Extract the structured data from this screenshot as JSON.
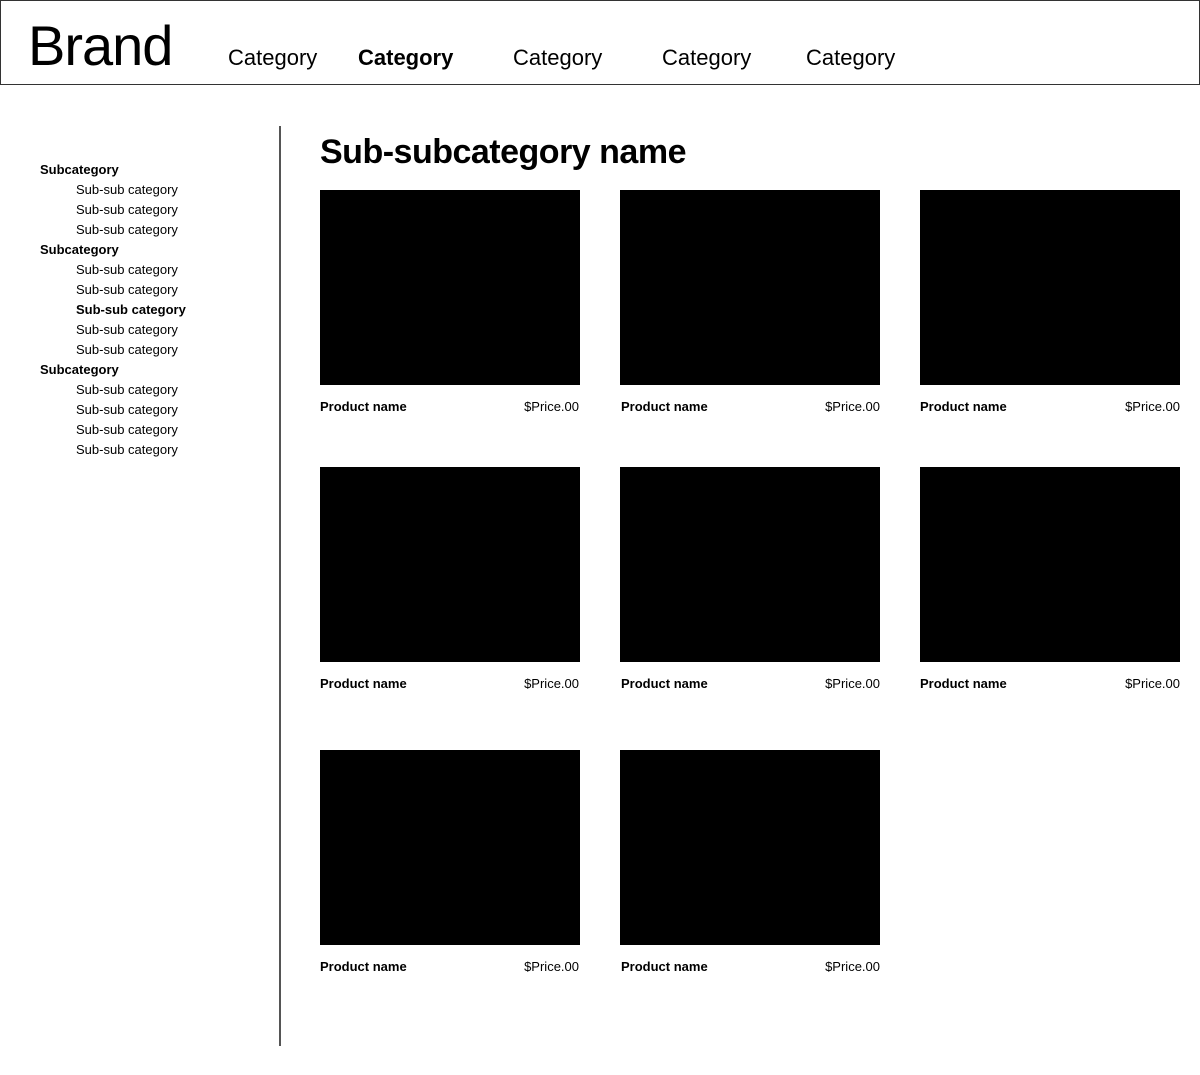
{
  "header": {
    "brand": "Brand",
    "nav": [
      {
        "label": "Category",
        "active": false
      },
      {
        "label": "Category",
        "active": true
      },
      {
        "label": "Category",
        "active": false
      },
      {
        "label": "Category",
        "active": false
      },
      {
        "label": "Category",
        "active": false
      }
    ]
  },
  "sidebar": {
    "groups": [
      {
        "label": "Subcategory",
        "items": [
          {
            "label": "Sub-sub category"
          },
          {
            "label": "Sub-sub category"
          },
          {
            "label": "Sub-sub category"
          }
        ]
      },
      {
        "label": "Subcategory",
        "items": [
          {
            "label": "Sub-sub category"
          },
          {
            "label": "Sub-sub category"
          },
          {
            "label": "Sub-sub category",
            "active": true
          },
          {
            "label": "Sub-sub category"
          },
          {
            "label": "Sub-sub category"
          }
        ]
      },
      {
        "label": "Subcategory",
        "items": [
          {
            "label": "Sub-sub category"
          },
          {
            "label": "Sub-sub category"
          },
          {
            "label": "Sub-sub category"
          },
          {
            "label": "Sub-sub category"
          }
        ]
      }
    ]
  },
  "main": {
    "title": "Sub-subcategory name",
    "products": [
      {
        "name": "Product name",
        "price": "$Price.00"
      },
      {
        "name": "Product name",
        "price": "$Price.00"
      },
      {
        "name": "Product name",
        "price": "$Price.00"
      },
      {
        "name": "Product name",
        "price": "$Price.00"
      },
      {
        "name": "Product name",
        "price": "$Price.00"
      },
      {
        "name": "Product name",
        "price": "$Price.00"
      },
      {
        "name": "Product name",
        "price": "$Price.00"
      },
      {
        "name": "Product name",
        "price": "$Price.00"
      }
    ]
  },
  "colors": {
    "image_placeholder": "#000000",
    "divider": "#555555"
  }
}
